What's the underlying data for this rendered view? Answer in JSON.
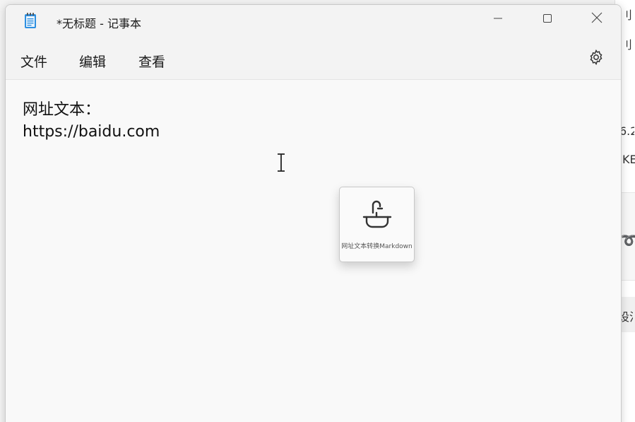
{
  "window": {
    "title": "*无标题 - 记事本"
  },
  "menu": {
    "file": "文件",
    "edit": "编辑",
    "view": "查看"
  },
  "editor": {
    "line1": "网址文本：",
    "line2": "https://baidu.com"
  },
  "popup": {
    "label": "网址文本转换Markdown",
    "icon": "faucet-sink-icon"
  },
  "background_window": {
    "fragments": [
      "刂",
      "刂",
      "6.2",
      "KE",
      "设汜"
    ]
  },
  "icons": {
    "app": "notepad-icon",
    "minimize": "minimize-icon",
    "maximize": "maximize-icon",
    "close": "close-icon",
    "settings": "gear-icon",
    "cursor": "text-cursor-icon"
  },
  "colors": {
    "accent_blue": "#1e6fd9",
    "window_bg": "#f9f9f9",
    "titlebar_bg": "#f3f3f3"
  }
}
